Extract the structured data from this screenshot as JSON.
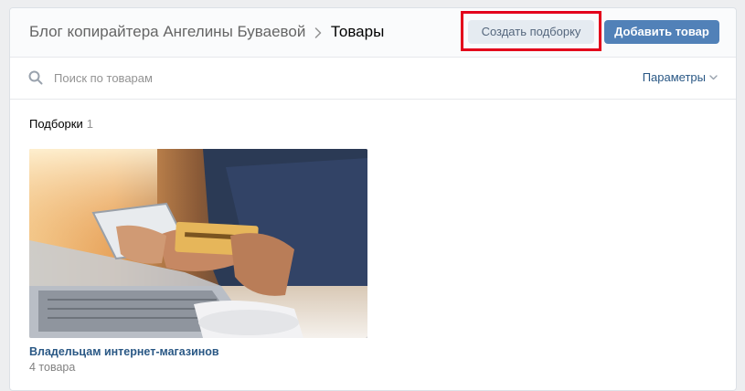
{
  "breadcrumb": {
    "group_name": "Блог копирайтера Ангелины Буваевой",
    "current": "Товары"
  },
  "actions": {
    "create_collection_label": "Создать подборку",
    "add_product_label": "Добавить товар"
  },
  "search": {
    "placeholder": "Поиск по товарам",
    "value": "",
    "params_label": "Параметры"
  },
  "collections": {
    "title": "Подборки",
    "count": "1",
    "items": [
      {
        "name": "Владельцам интернет-магазинов",
        "count_label": "4 товара"
      }
    ]
  },
  "icons": {
    "search": "search-icon",
    "breadcrumb_separator": "chevron-right-icon",
    "params_dropdown": "chevron-down-icon"
  },
  "colors": {
    "background": "#edeef0",
    "primary_button": "#5181b8",
    "secondary_button": "#e5ebf1",
    "link": "#2a5885",
    "highlight": "#e3001b"
  }
}
